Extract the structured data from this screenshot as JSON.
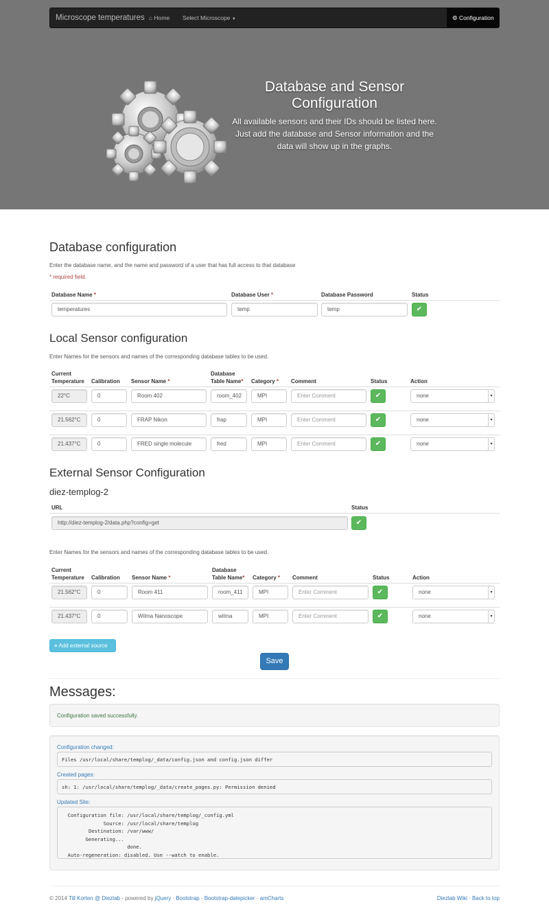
{
  "navbar": {
    "brand": "Microscope temperatures",
    "home": "Home",
    "select_microscope": "Select Microscope",
    "configuration": "Configuration"
  },
  "hero": {
    "title": "Database and Sensor Configuration",
    "subtitle": "All available sensors and their IDs should be listed here. Just add the database and Sensor information and the data will show up in the graphs."
  },
  "database": {
    "heading": "Database configuration",
    "lead": "Enter the database name, and the name and password of a user that has full access to that database",
    "required_note": "* required field.",
    "col_name": "Database Name",
    "col_user": "Database User",
    "col_password": "Database Password",
    "col_status": "Status",
    "name_value": "temperatures",
    "user_value": "temp",
    "password_value": "temp"
  },
  "local": {
    "heading": "Local Sensor configuration",
    "lead": "Enter Names for the sensors and names of the corresponding database tables to be used.",
    "cols": {
      "current1": "Current",
      "current2": "Temperature",
      "calibration": "Calibration",
      "sensor_name": "Sensor Name",
      "table1": "Database",
      "table2": "Table Name",
      "category": "Category",
      "comment": "Comment",
      "status": "Status",
      "action": "Action"
    },
    "rows": [
      {
        "temp": "22°C",
        "calibration": "0",
        "sensor": "Room 402",
        "table": "room_402",
        "category": "MPI",
        "comment_placeholder": "Enter Comment",
        "action": "none"
      },
      {
        "temp": "21.562°C",
        "calibration": "0",
        "sensor": "FRAP Nikon",
        "table": "frap",
        "category": "MPI",
        "comment_placeholder": "Enter Comment",
        "action": "none"
      },
      {
        "temp": "21.437°C",
        "calibration": "0",
        "sensor": "FRED single molecule",
        "table": "fred",
        "category": "MPI",
        "comment_placeholder": "Enter Comment",
        "action": "none"
      }
    ]
  },
  "external": {
    "heading": "External Sensor Configuration",
    "source_name": "diez-templog-2",
    "col_url": "URL",
    "col_status": "Status",
    "url_value": "http://diez-templog-2/data.php?config=get",
    "lead": "Enter Names for the sensors and names of the corresponding database tables to be used.",
    "rows": [
      {
        "temp": "21.562°C",
        "calibration": "0",
        "sensor": "Room 411",
        "table": "room_411",
        "category": "MPI",
        "comment_placeholder": "Enter Comment",
        "action": "none"
      },
      {
        "temp": "21.437°C",
        "calibration": "0",
        "sensor": "Wilma Nanoscope",
        "table": "wilma",
        "category": "MPI",
        "comment_placeholder": "Enter Comment",
        "action": "none"
      }
    ],
    "add_button": "Add external source"
  },
  "save_button": "Save",
  "messages": {
    "heading": "Messages:",
    "success": "Configuration saved successfully.",
    "config_changed_label": "Configuration changed:",
    "config_changed_text": "Files /usr/local/share/templog/_data/config.json and config.json differ",
    "created_pages_label": "Created pages:",
    "created_pages_text": "sh: 1: /usr/local/share/templog/_data/create_pages.py: Permission denied",
    "updated_site_label": "Updated Site:",
    "updated_site_text": "  Configuration file: /usr/local/share/templog/_config.yml\n              Source: /usr/local/share/templog\n         Destination: /var/www/\n        Generating...\n                      done.\n  Auto-regeneration: disabled. Use --watch to enable."
  },
  "footer": {
    "copyright": "© 2014",
    "author": "Till Korten @ Diezlab",
    "powered_by": " - powered by ",
    "jquery": "jQuery",
    "bootstrap": "Bootstrap",
    "datepicker": "Bootstrap-datepicker",
    "amcharts": "amCharts",
    "sep": " · ",
    "wiki": "Diezlab Wiki",
    "back_to_top": "Back to top"
  },
  "colors": {
    "hero_bg": "#767676",
    "navbar_bg": "#222222",
    "success": "#5cb85c",
    "primary": "#337ab7",
    "info": "#5bc0de",
    "required": "#a94442"
  },
  "icons": [
    "home-icon",
    "caret-down-icon",
    "gear-icon",
    "gears-illustration",
    "check-icon",
    "plus-icon"
  ]
}
